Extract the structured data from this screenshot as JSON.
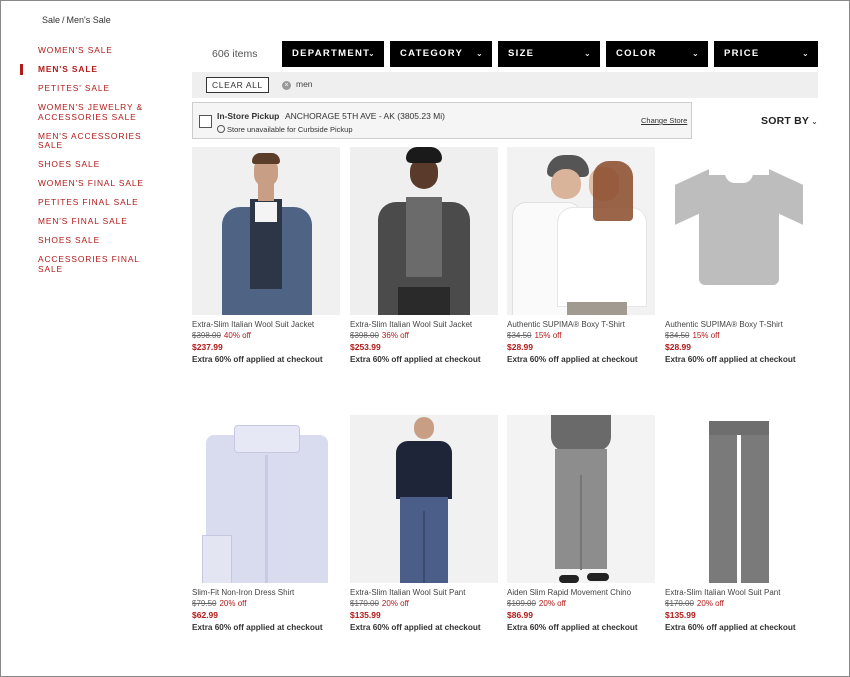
{
  "breadcrumb": {
    "parent": "Sale",
    "separator": "/",
    "current": "Men's Sale"
  },
  "sidebar": {
    "items": [
      {
        "label": "Women's Sale",
        "active": false
      },
      {
        "label": "Men's Sale",
        "active": true
      },
      {
        "label": "Petites' Sale",
        "active": false
      },
      {
        "label": "Women's Jewelry & Accessories Sale",
        "active": false
      },
      {
        "label": "Men's Accessories Sale",
        "active": false
      },
      {
        "label": "Shoes Sale",
        "active": false
      },
      {
        "label": "Women's Final Sale",
        "active": false
      },
      {
        "label": "Petites Final Sale",
        "active": false
      },
      {
        "label": "Men's Final Sale",
        "active": false
      },
      {
        "label": "Shoes Sale",
        "active": false
      },
      {
        "label": "Accessories Final Sale",
        "active": false
      }
    ]
  },
  "results": {
    "count": "606 items"
  },
  "filters": [
    "Department",
    "Category",
    "Size",
    "Color",
    "Price"
  ],
  "refine": {
    "clear_all": "CLEAR ALL",
    "chip": "men",
    "chip_remove_icon": "close-circle-icon"
  },
  "pickup": {
    "title": "In-Store Pickup",
    "store": "ANCHORAGE 5TH AVE - AK (3805.23 Mi)",
    "note": "Store unavailable for Curbside Pickup",
    "change": "Change Store"
  },
  "sort": {
    "label": "SORT BY",
    "icon": "chevron-down-icon"
  },
  "colors": {
    "accent_red": "#b21a1a",
    "filter_bg": "#000000",
    "refine_bg": "#efefef"
  },
  "products": [
    {
      "name": "Extra-Slim Italian Wool Suit Jacket",
      "orig": "$398.00",
      "disc": "40% off",
      "sale": "$237.99",
      "promo": "Extra 60% off applied at checkout"
    },
    {
      "name": "Extra-Slim Italian Wool Suit Jacket",
      "orig": "$398.00",
      "disc": "36% off",
      "sale": "$253.99",
      "promo": "Extra 60% off applied at checkout"
    },
    {
      "name": "Authentic SUPIMA® Boxy T-Shirt",
      "orig": "$34.50",
      "disc": "15% off",
      "sale": "$28.99",
      "promo": "Extra 60% off applied at checkout"
    },
    {
      "name": "Authentic SUPIMA® Boxy T-Shirt",
      "orig": "$34.50",
      "disc": "15% off",
      "sale": "$28.99",
      "promo": "Extra 60% off applied at checkout"
    },
    {
      "name": "Slim-Fit Non-Iron Dress Shirt",
      "orig": "$79.50",
      "disc": "20% off",
      "sale": "$62.99",
      "promo": "Extra 60% off applied at checkout"
    },
    {
      "name": "Extra-Slim Italian Wool Suit Pant",
      "orig": "$170.00",
      "disc": "20% off",
      "sale": "$135.99",
      "promo": "Extra 60% off applied at checkout"
    },
    {
      "name": "Aiden Slim Rapid Movement Chino",
      "orig": "$109.00",
      "disc": "20% off",
      "sale": "$86.99",
      "promo": "Extra 60% off applied at checkout"
    },
    {
      "name": "Extra-Slim Italian Wool Suit Pant",
      "orig": "$170.00",
      "disc": "20% off",
      "sale": "$135.99",
      "promo": "Extra 60% off applied at checkout"
    }
  ]
}
